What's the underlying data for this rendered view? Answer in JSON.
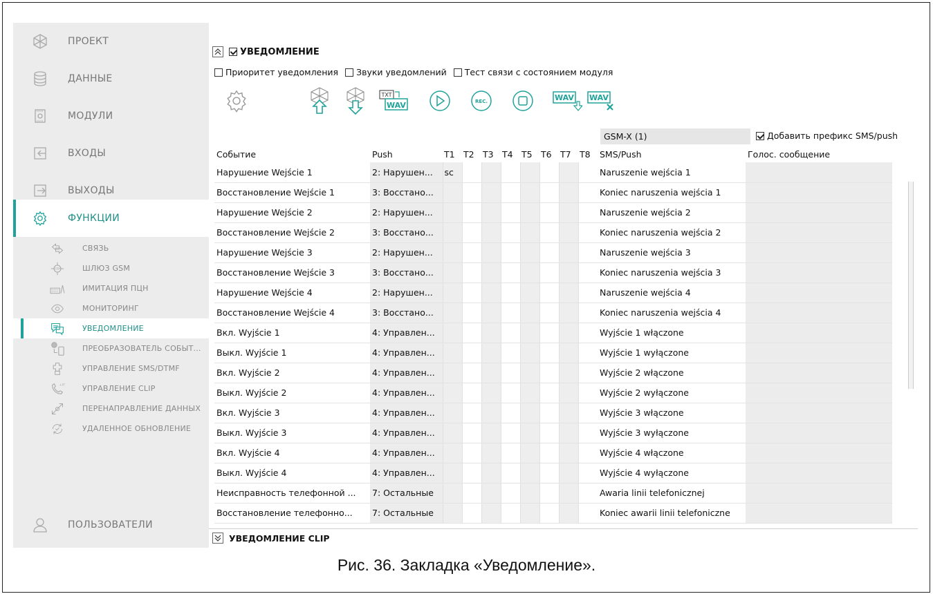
{
  "sidebar": {
    "main_items": [
      {
        "label": "ПРОЕКТ",
        "icon": "project-icon"
      },
      {
        "label": "ДАННЫЕ",
        "icon": "database-icon"
      },
      {
        "label": "МОДУЛИ",
        "icon": "module-icon"
      },
      {
        "label": "ВХОДЫ",
        "icon": "input-icon"
      },
      {
        "label": "ВЫХОДЫ",
        "icon": "output-icon"
      },
      {
        "label": "ФУНКЦИИ",
        "icon": "gear-icon",
        "active": true
      },
      {
        "label": "ПОЛЬЗОВАТЕЛИ",
        "icon": "user-icon"
      }
    ],
    "sub_items": [
      {
        "label": "СВЯЗЬ",
        "icon": "communication-icon"
      },
      {
        "label": "ШЛЮЗ GSM",
        "icon": "gsm-gateway-icon"
      },
      {
        "label": "ИМИТАЦИЯ ПЦН",
        "icon": "pcn-simulation-icon"
      },
      {
        "label": "МОНИТОРИНГ",
        "icon": "eye-icon"
      },
      {
        "label": "УВЕДОМЛЕНИЕ",
        "icon": "notification-icon",
        "active": true
      },
      {
        "label": "ПРЕОБРАЗОВАТЕЛЬ СОБЫТ...",
        "icon": "event-converter-icon"
      },
      {
        "label": "УПРАВЛЕНИЕ SMS/DTMF",
        "icon": "sms-control-icon"
      },
      {
        "label": "УПРАВЛЕНИЕ CLIP",
        "icon": "clip-control-icon"
      },
      {
        "label": "ПЕРЕНАПРАВЛЕНИЕ ДАННЫХ",
        "icon": "redirect-icon"
      },
      {
        "label": "УДАЛЕННОЕ ОБНОВЛЕНИЕ",
        "icon": "update-icon"
      }
    ]
  },
  "section": {
    "title": "УВЕДОМЛЕНИЕ",
    "enabled": true,
    "collapse_glyph": "≈",
    "options": [
      {
        "label": "Приоритет уведомления",
        "checked": false
      },
      {
        "label": "Звуки уведомлений",
        "checked": false
      },
      {
        "label": "Тест связи с состоянием модуля",
        "checked": false
      }
    ]
  },
  "toolbar": {
    "icons": [
      "settings-icon",
      "upload-icon",
      "download-icon",
      "txt-to-wav-icon",
      "play-icon",
      "record-icon",
      "stop-icon",
      "wav-download-icon",
      "wav-delete-icon"
    ],
    "txt_label": "TXT",
    "wav_label": "WAV",
    "rec_label": "REC."
  },
  "gsm": {
    "label": "GSM-X (1)",
    "prefix_label": "Добавить префикс SMS/push",
    "prefix_checked": true
  },
  "table": {
    "headers": {
      "event": "Событие",
      "push": "Push",
      "t": [
        "T1",
        "T2",
        "T3",
        "T4",
        "T5",
        "T6",
        "T7",
        "T8"
      ],
      "sms": "SMS/Push",
      "voice": "Голос. сообщение"
    },
    "rows": [
      {
        "event": "Нарушение Wejście 1",
        "push": "2: Нарушен...",
        "t1": "sc",
        "sms": "Naruszenie wejścia 1"
      },
      {
        "event": "Восстановление Wejście 1",
        "push": "3: Восстано...",
        "t1": "",
        "sms": "Koniec naruszenia wejścia 1"
      },
      {
        "event": "Нарушение Wejście 2",
        "push": "2: Нарушен...",
        "t1": "",
        "sms": "Naruszenie wejścia 2"
      },
      {
        "event": "Восстановление Wejście 2",
        "push": "3: Восстано...",
        "t1": "",
        "sms": "Koniec naruszenia wejścia 2"
      },
      {
        "event": "Нарушение Wejście 3",
        "push": "2: Нарушен...",
        "t1": "",
        "sms": "Naruszenie wejścia 3"
      },
      {
        "event": "Восстановление Wejście 3",
        "push": "3: Восстано...",
        "t1": "",
        "sms": "Koniec naruszenia wejścia 3"
      },
      {
        "event": "Нарушение Wejście 4",
        "push": "2: Нарушен...",
        "t1": "",
        "sms": "Naruszenie wejścia 4"
      },
      {
        "event": "Восстановление Wejście 4",
        "push": "3: Восстано...",
        "t1": "",
        "sms": "Koniec naruszenia wejścia 4"
      },
      {
        "event": "Вкл. Wyjście 1",
        "push": "4: Управлен...",
        "t1": "",
        "sms": "Wyjście 1 włączone"
      },
      {
        "event": "Выкл. Wyjście 1",
        "push": "4: Управлен...",
        "t1": "",
        "sms": "Wyjście 1 wyłączone"
      },
      {
        "event": "Вкл. Wyjście 2",
        "push": "4: Управлен...",
        "t1": "",
        "sms": "Wyjście 2 włączone"
      },
      {
        "event": "Выкл. Wyjście 2",
        "push": "4: Управлен...",
        "t1": "",
        "sms": "Wyjście 2 wyłączone"
      },
      {
        "event": "Вкл. Wyjście 3",
        "push": "4: Управлен...",
        "t1": "",
        "sms": "Wyjście 3 włączone"
      },
      {
        "event": "Выкл. Wyjście 3",
        "push": "4: Управлен...",
        "t1": "",
        "sms": "Wyjście 3 wyłączone"
      },
      {
        "event": "Вкл. Wyjście 4",
        "push": "4: Управлен...",
        "t1": "",
        "sms": "Wyjście 4 włączone"
      },
      {
        "event": "Выкл. Wyjście 4",
        "push": "4: Управлен...",
        "t1": "",
        "sms": "Wyjście 4 wyłączone"
      },
      {
        "event": "Неисправность телефонной ...",
        "push": "7: Остальные",
        "t1": "",
        "sms": "Awaria linii telefonicznej"
      },
      {
        "event": "Восстановление телефонно...",
        "push": "7: Остальные",
        "t1": "",
        "sms": "Koniec awarii linii telefoniczne"
      }
    ]
  },
  "clip_section": {
    "title": "УВЕДОМЛЕНИЕ CLIP",
    "expand_glyph": "≈"
  },
  "caption": "Рис. 36. Закладка «Уведомление».",
  "colors": {
    "accent": "#1fa39a",
    "sidebar_bg": "#ececec",
    "cell_gray": "#ececec"
  }
}
